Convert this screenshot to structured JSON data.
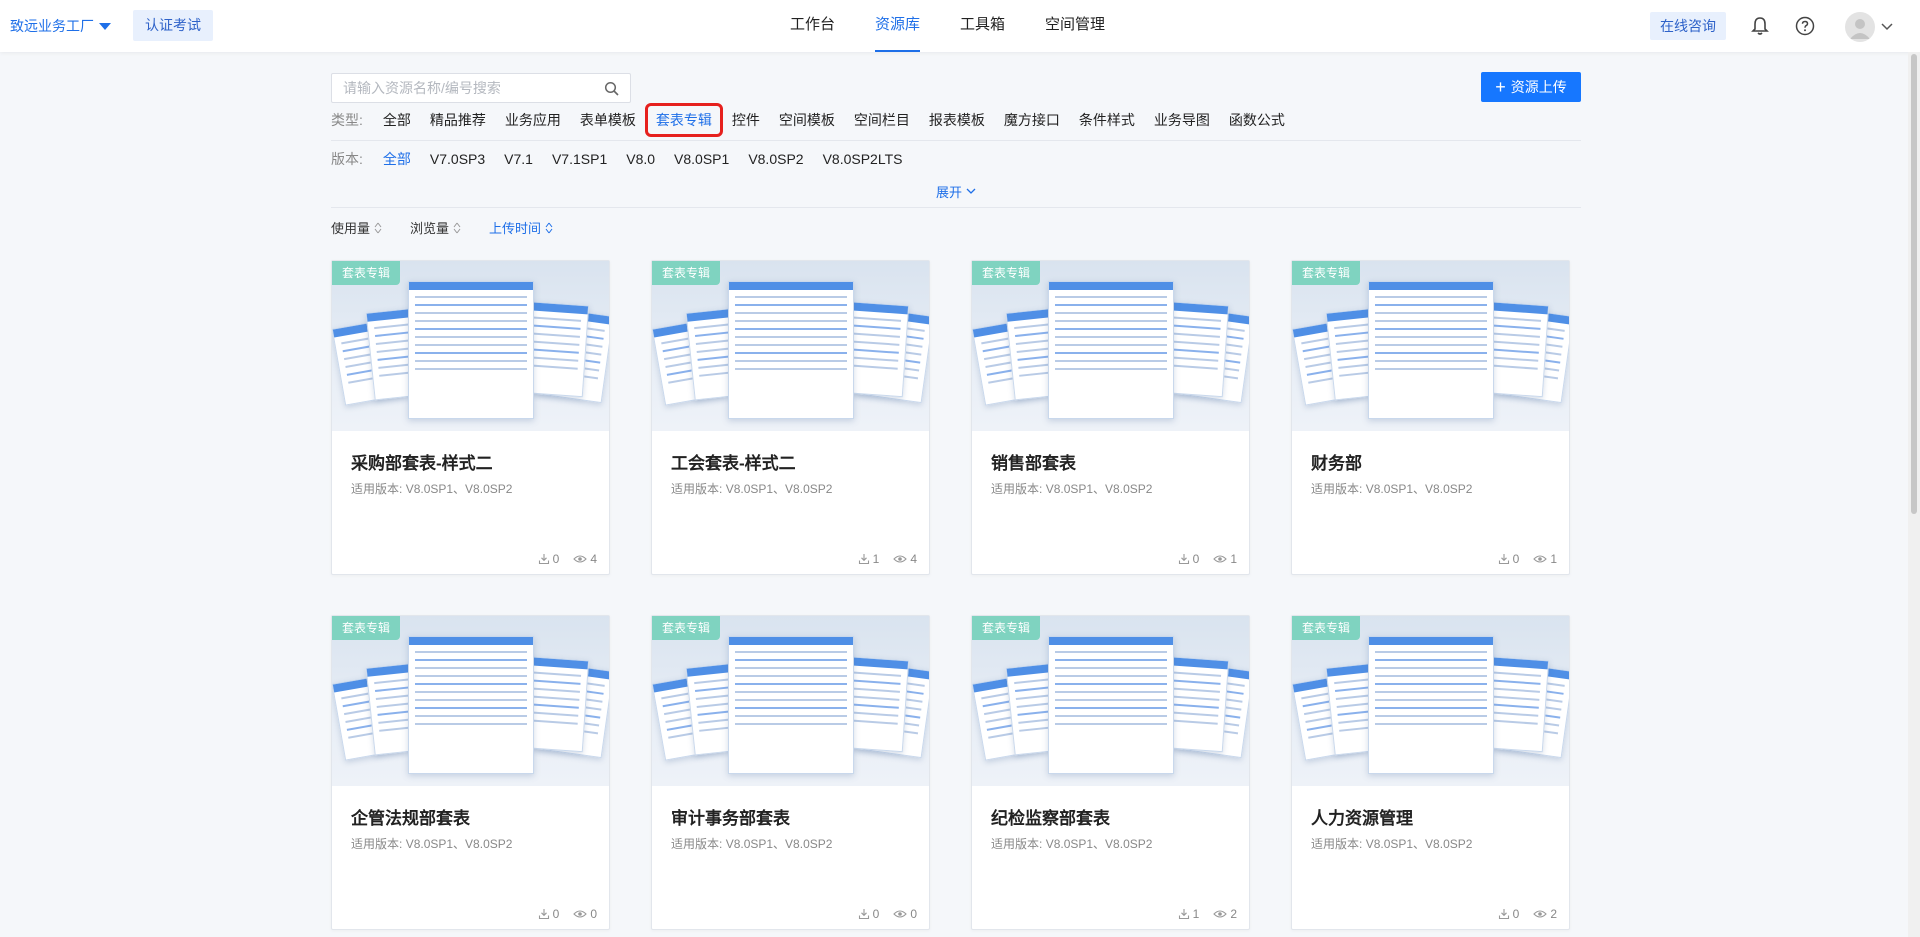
{
  "header": {
    "brand": "致远业务工厂",
    "cert_label": "认证考试",
    "nav": [
      "工作台",
      "资源库",
      "工具箱",
      "空间管理"
    ],
    "active_nav": 1,
    "consult_label": "在线咨询"
  },
  "search": {
    "placeholder": "请输入资源名称/编号搜索"
  },
  "upload_label": "资源上传",
  "type_filter": {
    "label": "类型:",
    "options": [
      "全部",
      "精品推荐",
      "业务应用",
      "表单模板",
      "套表专辑",
      "控件",
      "空间模板",
      "空间栏目",
      "报表模板",
      "魔方接口",
      "条件样式",
      "业务导图",
      "函数公式"
    ],
    "selected": 4
  },
  "version_filter": {
    "label": "版本:",
    "options": [
      "全部",
      "V7.0SP3",
      "V7.1",
      "V7.1SP1",
      "V8.0",
      "V8.0SP1",
      "V8.0SP2",
      "V8.0SP2LTS"
    ],
    "selected": 0
  },
  "expand_label": "展开",
  "sort": {
    "options": [
      "使用量",
      "浏览量",
      "上传时间"
    ],
    "selected": 2
  },
  "cards": [
    {
      "tag": "套表专辑",
      "title": "采购部套表-样式二",
      "version_label": "适用版本:",
      "versions": "V8.0SP1、V8.0SP2",
      "downloads": "0",
      "views": "4"
    },
    {
      "tag": "套表专辑",
      "title": "工会套表-样式二",
      "version_label": "适用版本:",
      "versions": "V8.0SP1、V8.0SP2",
      "downloads": "1",
      "views": "4"
    },
    {
      "tag": "套表专辑",
      "title": "销售部套表",
      "version_label": "适用版本:",
      "versions": "V8.0SP1、V8.0SP2",
      "downloads": "0",
      "views": "1"
    },
    {
      "tag": "套表专辑",
      "title": "财务部",
      "version_label": "适用版本:",
      "versions": "V8.0SP1、V8.0SP2",
      "downloads": "0",
      "views": "1"
    },
    {
      "tag": "套表专辑",
      "title": "企管法规部套表",
      "version_label": "适用版本:",
      "versions": "V8.0SP1、V8.0SP2",
      "downloads": "0",
      "views": "0"
    },
    {
      "tag": "套表专辑",
      "title": "审计事务部套表",
      "version_label": "适用版本:",
      "versions": "V8.0SP1、V8.0SP2",
      "downloads": "0",
      "views": "0"
    },
    {
      "tag": "套表专辑",
      "title": "纪检监察部套表",
      "version_label": "适用版本:",
      "versions": "V8.0SP1、V8.0SP2",
      "downloads": "1",
      "views": "2"
    },
    {
      "tag": "套表专辑",
      "title": "人力资源管理",
      "version_label": "适用版本:",
      "versions": "V8.0SP1、V8.0SP2",
      "downloads": "0",
      "views": "2"
    }
  ],
  "colors": {
    "accent": "#1e6fe8",
    "highlight_box": "#e6201d",
    "tag": "#7fd3c0",
    "upload_button": "#1677ff"
  },
  "icons": [
    "caret-down-icon",
    "bell-icon",
    "help-icon",
    "avatar-icon",
    "chevron-down-icon",
    "search-icon",
    "plus-icon",
    "download-icon",
    "eye-icon"
  ]
}
